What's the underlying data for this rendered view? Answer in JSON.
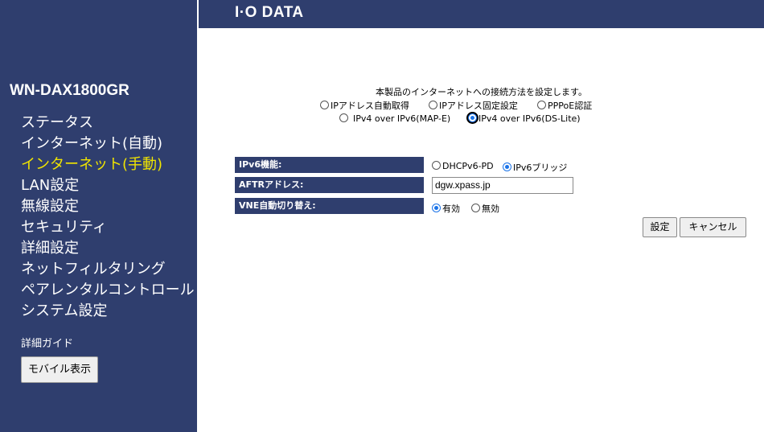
{
  "header": {
    "logo": "I·O DATA"
  },
  "sidebar": {
    "model": "WN-DAX1800GR",
    "items": [
      {
        "label": "ステータス",
        "active": false
      },
      {
        "label": "インターネット(自動)",
        "active": false
      },
      {
        "label": "インターネット(手動)",
        "active": true
      },
      {
        "label": "LAN設定",
        "active": false
      },
      {
        "label": "無線設定",
        "active": false
      },
      {
        "label": "セキュリティ",
        "active": false
      },
      {
        "label": "詳細設定",
        "active": false
      },
      {
        "label": "ネットフィルタリング",
        "active": false
      },
      {
        "label": "ペアレンタルコントロール",
        "active": false
      },
      {
        "label": "システム設定",
        "active": false
      }
    ],
    "guide": "詳細ガイド",
    "mobile_button": "モバイル表示"
  },
  "connection": {
    "intro": "本製品のインターネットへの接続方法を設定します。",
    "options": [
      {
        "label": "IPアドレス自動取得",
        "checked": false
      },
      {
        "label": "IPアドレス固定設定",
        "checked": false
      },
      {
        "label": "PPPoE認証",
        "checked": false
      },
      {
        "label": "IPv4 over IPv6(MAP-E)",
        "checked": false
      },
      {
        "label": "IPv4 over IPv6(DS-Lite)",
        "checked": true
      }
    ]
  },
  "form": {
    "ipv6_function": {
      "label": "IPv6機能:",
      "options": [
        {
          "label": "DHCPv6-PD",
          "checked": false
        },
        {
          "label": "IPv6ブリッジ",
          "checked": true
        }
      ]
    },
    "aftr": {
      "label": "AFTRアドレス:",
      "value": "dgw.xpass.jp"
    },
    "vne_auto_switch": {
      "label": "VNE自動切り替え:",
      "options": [
        {
          "label": "有効",
          "checked": true
        },
        {
          "label": "無効",
          "checked": false
        }
      ]
    }
  },
  "buttons": {
    "save": "設定",
    "cancel": "キャンセル"
  },
  "colors": {
    "navy": "#2f3e6e",
    "active_nav": "#f0e400",
    "radio_selected": "#1a73e8"
  }
}
